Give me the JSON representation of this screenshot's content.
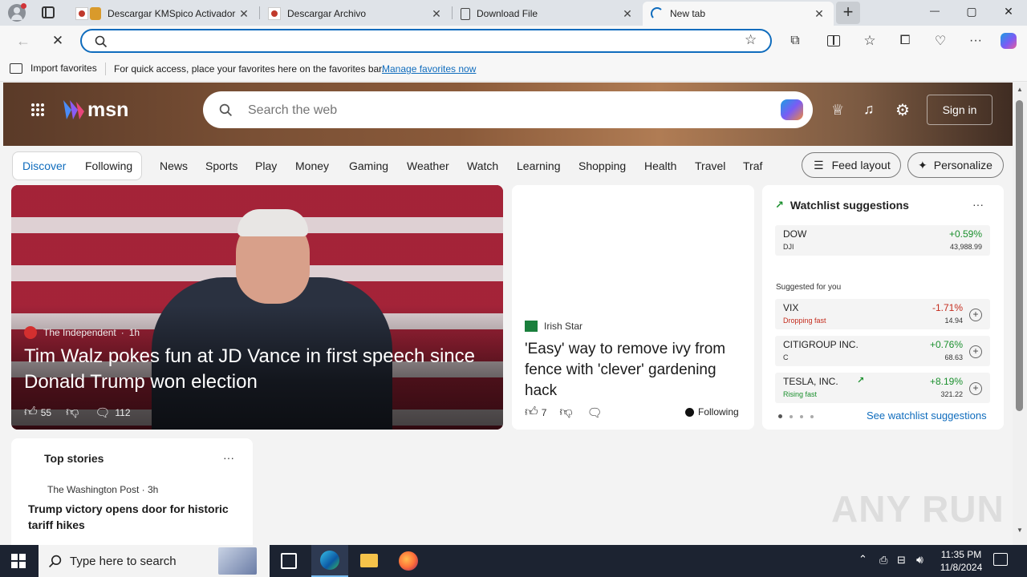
{
  "tabs": [
    {
      "title": "Descargar KMSpico Activador",
      "active": false
    },
    {
      "title": "Descargar Archivo",
      "active": false
    },
    {
      "title": "Download File",
      "active": false
    },
    {
      "title": "New tab",
      "active": true
    }
  ],
  "window": {
    "minimize": "—",
    "maximize": "▢",
    "close": "✕",
    "new_tab": "+"
  },
  "address": {
    "value": "",
    "placeholder": ""
  },
  "favorites_bar": {
    "import_label": "Import favorites",
    "hint": "For quick access, place your favorites here on the favorites bar.",
    "manage_link": "Manage favorites now"
  },
  "msn": {
    "logo": "msn",
    "search_placeholder": "Search the web",
    "sign_in": "Sign in",
    "nav_pill": [
      "Discover",
      "Following"
    ],
    "nav_items": [
      "News",
      "Sports",
      "Play",
      "Money",
      "Gaming",
      "Weather",
      "Watch",
      "Learning",
      "Shopping",
      "Health",
      "Travel",
      "Traf"
    ],
    "feed_layout": "Feed layout",
    "personalize": "Personalize"
  },
  "hero_story": {
    "source": "The Independent",
    "age": "1h",
    "headline": "Tim Walz pokes fun at JD Vance in first speech since Donald Trump won election",
    "likes": "55",
    "comments": "112"
  },
  "side_story": {
    "source": "Irish Star",
    "headline": "'Easy' way to remove ivy from fence with 'clever' gardening hack",
    "likes": "7",
    "following": "Following"
  },
  "watchlist": {
    "title": "Watchlist suggestions",
    "more": "···",
    "top": {
      "symbol": "DOW",
      "sub": "DJI",
      "change": "+0.59%",
      "price": "43,988.99"
    },
    "suggested_label": "Suggested for you",
    "items": [
      {
        "symbol": "VIX",
        "sub": "Dropping fast",
        "change": "-1.71%",
        "price": "14.94"
      },
      {
        "symbol": "CITIGROUP INC.",
        "sub": "C",
        "change": "+0.76%",
        "price": "68.63"
      },
      {
        "symbol": "TESLA, INC.",
        "sub": "Rising fast",
        "change": "+8.19%",
        "price": "321.22"
      }
    ],
    "see_more": "See watchlist suggestions",
    "colors": {
      "up": "#1a8f2d",
      "down": "#c42b1c"
    }
  },
  "top_stories": {
    "title": "Top stories",
    "more": "···",
    "source": "The Washington Post · 3h",
    "headline": "Trump victory opens door for historic tariff hikes"
  },
  "taskbar": {
    "search_placeholder": "Type here to search",
    "time": "11:35 PM",
    "date": "11/8/2024"
  },
  "watermark": "ANY RUN"
}
